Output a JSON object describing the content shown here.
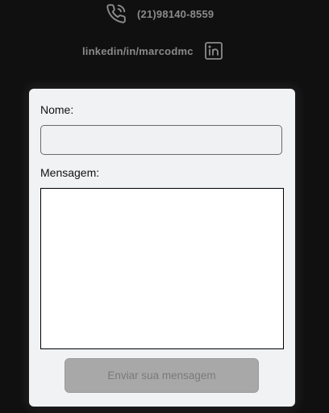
{
  "contact": {
    "phone": "(21)98140-8559",
    "phone_icon": "phone-icon",
    "linkedin": "linkedin/in/marcodmc",
    "linkedin_icon": "linkedin-icon"
  },
  "form": {
    "name_label": "Nome:",
    "name_value": "",
    "message_label": "Mensagem:",
    "message_value": "",
    "submit_label": "Enviar sua mensagem"
  },
  "colors": {
    "background": "#101010",
    "card": "#f1f2f4",
    "muted_text": "#8a8a8a",
    "button_disabled": "#a8a8a8"
  }
}
